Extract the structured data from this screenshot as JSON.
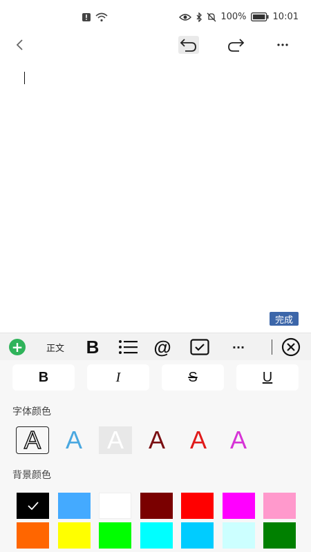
{
  "status_bar": {
    "battery_percent": "100%",
    "time": "10:01",
    "icons": [
      "alert-icon",
      "wifi-icon",
      "eye-icon",
      "bluetooth-icon",
      "mute-icon",
      "battery-icon"
    ]
  },
  "top_bar": {
    "icons": [
      "chevron-left-icon",
      "undo-icon",
      "redo-icon",
      "more-icon"
    ]
  },
  "editor": {
    "content": "",
    "done_label": "完成"
  },
  "format_bar": {
    "add_icon": "plus-icon",
    "text_style_label": "正文",
    "bold_label": "B",
    "list_icon": "bullet-list-icon",
    "mention_label": "@",
    "checkbox_icon": "checkbox-icon",
    "more_label": "···",
    "close_icon": "close-circle-icon"
  },
  "text_styles": [
    {
      "label": "B",
      "style": "bold"
    },
    {
      "label": "I",
      "style": "italic"
    },
    {
      "label": "S",
      "style": "strikethrough"
    },
    {
      "label": "U",
      "style": "underline"
    }
  ],
  "font_color": {
    "label": "字体颜色",
    "letter": "A",
    "options": [
      {
        "color": "#ffffff",
        "stroke": "#111111",
        "selected": true
      },
      {
        "color": "#4aa8e0",
        "stroke": "#ffffff",
        "selected": false
      },
      {
        "color": "#ffffff",
        "stroke": "#d0d0d0",
        "bg": "#e8e8e8",
        "selected": false
      },
      {
        "color": "#7a0f12",
        "stroke": "#f0c8c8",
        "selected": false
      },
      {
        "color": "#e01a1a",
        "stroke": "#f5c0c0",
        "selected": false
      },
      {
        "color": "#d633d6",
        "stroke": "#f3c0f3",
        "selected": false
      }
    ]
  },
  "background_color": {
    "label": "背景颜色",
    "rows": [
      [
        "#000000",
        "#44aaff",
        "#ffffff",
        "#7a0000",
        "#ff0000",
        "#ff00ff",
        "#ff99cc"
      ],
      [
        "#ff6600",
        "#ffff00",
        "#00ff00",
        "#00ffff",
        "#00ccff",
        "#ccffff",
        "#008000"
      ]
    ],
    "selected_index": 0
  }
}
